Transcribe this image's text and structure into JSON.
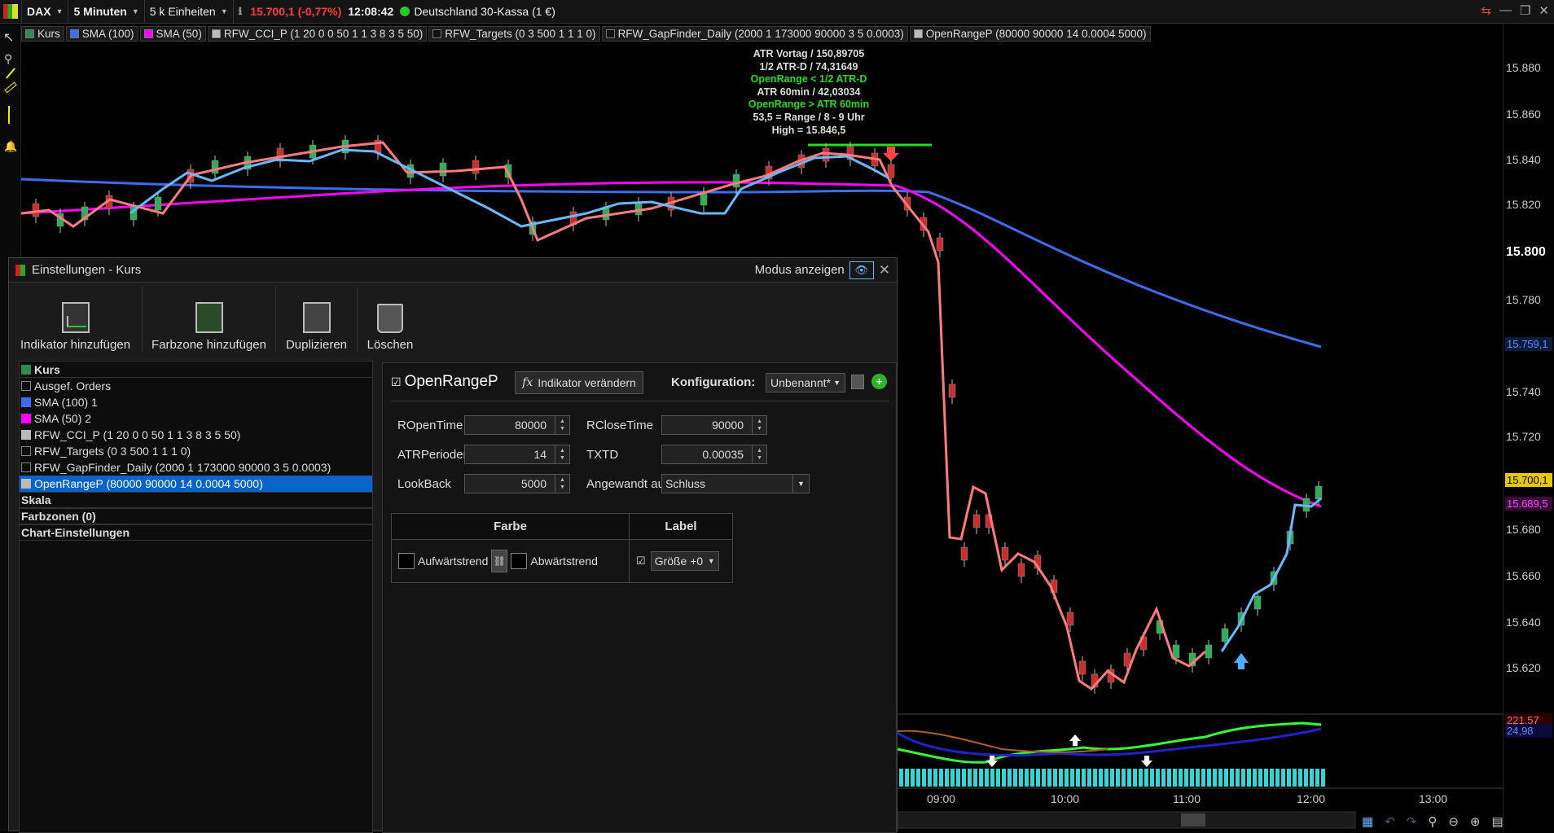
{
  "topbar": {
    "symbol": "DAX",
    "interval": "5 Minuten",
    "units": "5 k Einheiten",
    "price_change": "15.700,1 (-0,77%)",
    "time": "12:08:42",
    "market": "Deutschland 30-Kassa (1 €)"
  },
  "legend": [
    {
      "label": "Kurs",
      "color": "#2e8b57"
    },
    {
      "label": "SMA (100)",
      "color": "#3a6df0"
    },
    {
      "label": "SMA (50)",
      "color": "#ff00ff"
    },
    {
      "label": "RFW_CCI_P (1 20 0 0 50 1 1 3 8 3 5 50)",
      "color": "#bbbbbb"
    },
    {
      "label": "RFW_Targets (0 3 500 1 1 1 0)",
      "color": "#111111"
    },
    {
      "label": "RFW_GapFinder_Daily (2000 1 173000 90000 3 5 0.0003)",
      "color": "#111111"
    },
    {
      "label": "OpenRangeP (80000 90000 14 0.0004 5000)",
      "color": "#bbbbbb"
    }
  ],
  "annotations": [
    {
      "text": "ATR Vortag / 150,89705",
      "color": "#dddddd"
    },
    {
      "text": "1/2 ATR-D / 74,31649",
      "color": "#dddddd"
    },
    {
      "text": "OpenRange < 1/2 ATR-D",
      "color": "#22dd22"
    },
    {
      "text": "ATR 60min / 42,03034",
      "color": "#dddddd"
    },
    {
      "text": "OpenRange > ATR 60min",
      "color": "#22dd22"
    },
    {
      "text": "53,5  = Range / 8 - 9  Uhr",
      "color": "#dddddd"
    },
    {
      "text": "High = 15.846,5",
      "color": "#dddddd"
    }
  ],
  "price_axis": [
    "15.880",
    "15.860",
    "15.840",
    "15.820",
    "15.800",
    "15.780",
    "15.740",
    "15.720",
    "15.700",
    "15.680",
    "15.660",
    "15.640",
    "15.620"
  ],
  "price_tags": [
    {
      "text": "15.759,1",
      "bg": "#0c1c3a",
      "color": "#5b8cff"
    },
    {
      "text": "15.700,1",
      "bg": "#e8c600",
      "color": "#000000"
    },
    {
      "text": "15.689,5",
      "bg": "#3a0a3a",
      "color": "#ff44ff"
    },
    {
      "text": "221,57",
      "bg": "#2a0000",
      "color": "#ff6666"
    },
    {
      "text": "24,98",
      "bg": "#0a0a3a",
      "color": "#6688ff"
    }
  ],
  "time_axis": [
    "09:00",
    "10:00",
    "11:00",
    "12:00",
    "13:00"
  ],
  "dialog": {
    "title": "Einstellungen - Kurs",
    "mode_label": "Modus anzeigen",
    "toolbar": [
      "Indikator hinzufügen",
      "Farbzone hinzufügen",
      "Duplizieren",
      "Löschen"
    ],
    "tree": [
      {
        "label": "Kurs",
        "color": "#2e8b57",
        "bold": true
      },
      {
        "label": "Ausgef. Orders",
        "color": ""
      },
      {
        "label": "SMA (100) 1",
        "color": "#3a6df0"
      },
      {
        "label": "SMA (50) 2",
        "color": "#ff00ff"
      },
      {
        "label": "RFW_CCI_P (1 20 0 0 50 1 1 3 8 3 5 50)",
        "color": "#bbbbbb"
      },
      {
        "label": "RFW_Targets (0 3 500 1 1 1 0)",
        "color": ""
      },
      {
        "label": "RFW_GapFinder_Daily (2000 1 173000 90000 3 5 0.0003)",
        "color": ""
      },
      {
        "label": "OpenRangeP (80000 90000 14 0.0004 5000)",
        "color": "#bbbbbb",
        "selected": true
      }
    ],
    "tree_sections": [
      "Skala",
      "Farbzonen (0)",
      "Chart-Einstellungen"
    ],
    "indicator_name": "OpenRangeP",
    "change_button": "Indikator verändern",
    "config_label": "Konfiguration:",
    "config_value": "Unbenannt*",
    "params": {
      "ropen_label": "ROpenTime",
      "ropen_value": "80000",
      "rclose_label": "RCloseTime",
      "rclose_value": "90000",
      "atr_label": "ATRPerioden",
      "atr_value": "14",
      "txtd_label": "TXTD",
      "txtd_value": "0.00035",
      "lookback_label": "LookBack",
      "lookback_value": "5000",
      "applied_label": "Angewandt auf",
      "applied_value": "Schluss"
    },
    "color_header": "Farbe",
    "label_header": "Label",
    "up_label": "Aufwärtstrend",
    "down_label": "Abwärtstrend",
    "size_value": "Größe +0"
  }
}
